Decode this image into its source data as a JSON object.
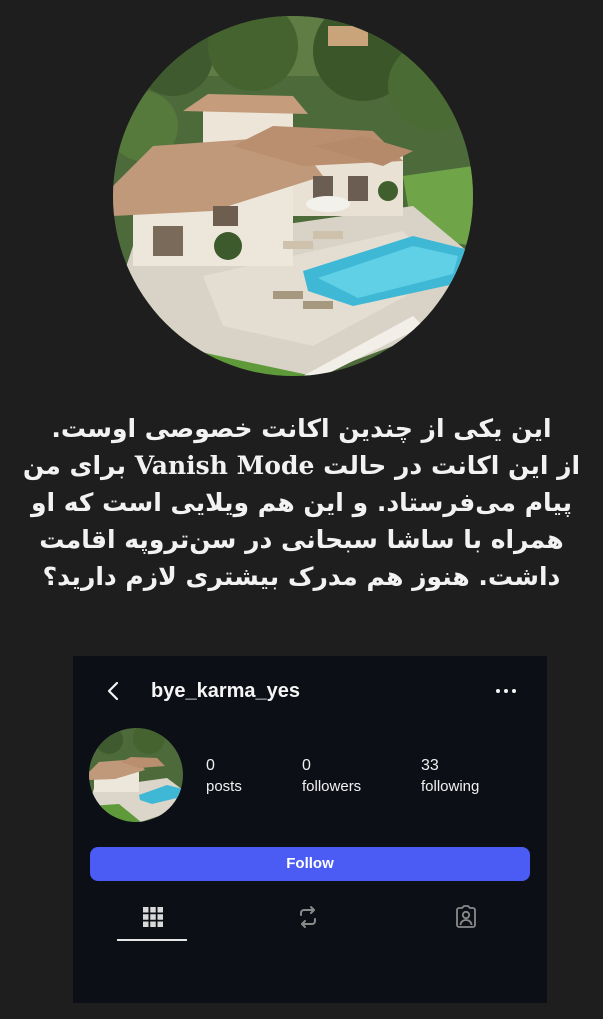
{
  "caption": {
    "line1": "این یکی از چندین اکانت خصوصی اوست.",
    "line2_before": "از این اکانت در حالت ",
    "line2_english": "Vanish Mode",
    "line2_after": " برای من",
    "line3": "پیام می‌فرستاد. و این هم ویلایی است که او",
    "line4": "همراه با ساشا سبحانی در سن‌تروپه اقامت",
    "line5": "داشت. هنوز هم مدرک بیشتری لازم دارید؟"
  },
  "profile": {
    "username": "bye_karma_yes",
    "stats": [
      {
        "value": "0",
        "label": "posts"
      },
      {
        "value": "0",
        "label": "followers"
      },
      {
        "value": "33",
        "label": "following"
      }
    ],
    "follow_label": "Follow",
    "active_tab": "grid"
  },
  "icons": {
    "back": "chevron-left-icon",
    "more": "more-horizontal-icon",
    "grid": "grid-icon",
    "reels": "repost-icon",
    "tagged": "tagged-person-icon"
  },
  "colors": {
    "page_background": "#1e1e1e",
    "card_background": "#0d0f17",
    "follow_button": "#4b5cf5",
    "text": "#f2f2f2"
  }
}
